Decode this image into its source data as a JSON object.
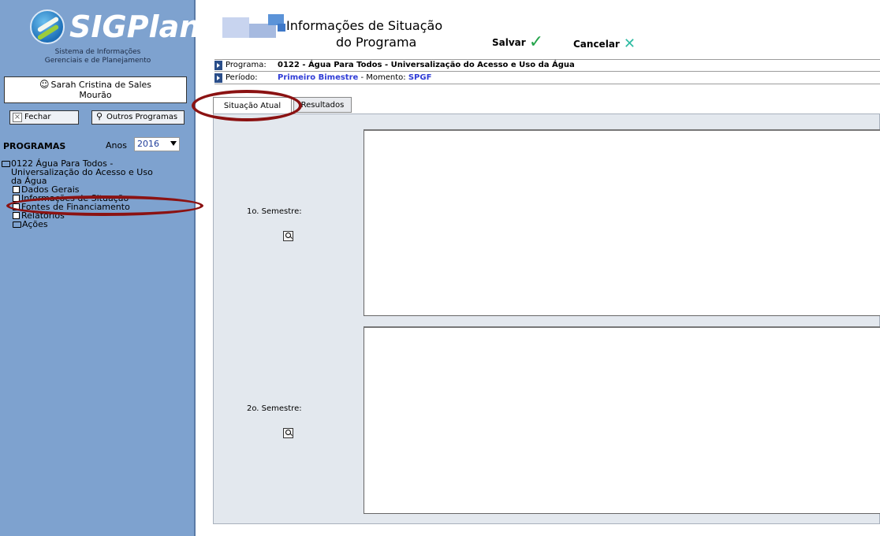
{
  "sidebar": {
    "logo_text": "SIGPlan",
    "logo_subtitle_1": "Sistema de Informações",
    "logo_subtitle_2": "Gerenciais e de Planejamento",
    "user_name_1": "Sarah Cristina de Sales",
    "user_name_2": "Mourão",
    "btn_fechar": "Fechar",
    "btn_outros": "Outros Programas",
    "programas_label": "PROGRAMAS",
    "anos_label": "Anos",
    "anos_value": "2016",
    "tree": {
      "root_1": "0122 Água Para Todos -",
      "root_2": "Universalização do Acesso e Uso",
      "root_3": "da Água",
      "items": [
        {
          "label": "Dados Gerais"
        },
        {
          "label": "Informações de Situação"
        },
        {
          "label": "Fontes de Financiamento"
        },
        {
          "label": "Relatórios"
        },
        {
          "label": "Ações"
        }
      ]
    }
  },
  "header": {
    "title_1": "Informações de Situação",
    "title_2": "do Programa",
    "salvar": "Salvar",
    "cancelar": "Cancelar"
  },
  "info": {
    "programa_label": "Programa:",
    "programa_value": "0122 - Água Para Todos - Universalização do Acesso e Uso da Água",
    "periodo_label": "Período:",
    "periodo_value": "Primeiro Bimestre",
    "momento_sep": " - Momento: ",
    "momento_value": "SPGF"
  },
  "tabs": {
    "situacao": "Situação Atual",
    "resultados": "Resultados"
  },
  "content": {
    "sem1_label": "1o. Semestre:",
    "sem2_label": "2o. Semestre:",
    "sem1_value": "",
    "sem2_value": ""
  },
  "colors": {
    "sidebar_bg": "#7ea2cf",
    "annotation": "#8b1212",
    "blue_text": "#2f3cd6",
    "salvar_check": "#23a44a",
    "cancelar_x": "#2dbba2"
  }
}
